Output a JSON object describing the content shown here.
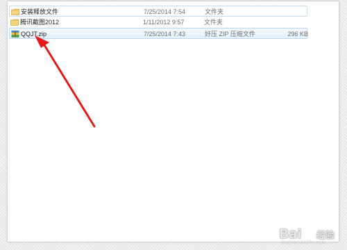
{
  "files": [
    {
      "name": "安装释放文件",
      "date": "7/25/2014 7:54",
      "type": "文件夹",
      "size": "",
      "icon": "folder-icon"
    },
    {
      "name": "腾讯截图2012",
      "date": "1/11/2012 9:57",
      "type": "文件夹",
      "size": "",
      "icon": "folder-icon"
    },
    {
      "name": "QQJT.zip",
      "date": "7/25/2014 7:43",
      "type": "好压 ZIP 压缩文件",
      "size": "296 KB",
      "icon": "zip-archive-icon"
    }
  ],
  "watermark": {
    "brand": "Bai",
    "brand_cn": "经验",
    "url": "jingyan.baidu.com"
  },
  "colors": {
    "arrow": "#e21a1a",
    "folder": "#e8c15a",
    "selection_border": "#bcd6f0"
  }
}
